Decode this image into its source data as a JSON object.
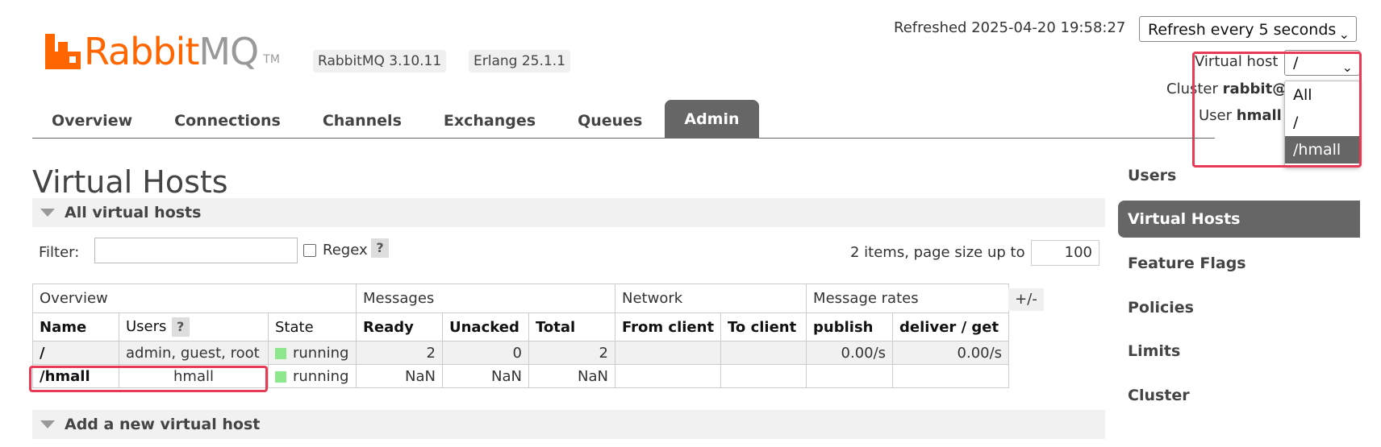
{
  "header": {
    "logo_rabbit": "Rabbit",
    "logo_mq": "MQ",
    "logo_tm": "TM",
    "rabbitmq_version": "RabbitMQ 3.10.11",
    "erlang_version": "Erlang 25.1.1",
    "refreshed_text": "Refreshed 2025-04-20 19:58:27",
    "refresh_select_value": "Refresh every 5 seconds",
    "virtual_host_label": "Virtual host",
    "virtual_host_value": "/",
    "virtual_host_options": [
      "All",
      "/",
      "/hmall"
    ],
    "virtual_host_highlighted": "/hmall",
    "cluster_label": "Cluster",
    "cluster_value": "rabbit@",
    "user_label": "User",
    "user_value": "hmall"
  },
  "tabs": [
    "Overview",
    "Connections",
    "Channels",
    "Exchanges",
    "Queues",
    "Admin"
  ],
  "active_tab": "Admin",
  "page_title": "Virtual Hosts",
  "section_all": "All virtual hosts",
  "filter": {
    "label": "Filter:",
    "value": "",
    "regex_label": "Regex",
    "help": "?",
    "items_text": "2 items, page size up to",
    "page_size": "100"
  },
  "table": {
    "groups": [
      "Overview",
      "Messages",
      "Network",
      "Message rates"
    ],
    "columns": [
      "Name",
      "Users",
      "State",
      "Ready",
      "Unacked",
      "Total",
      "From client",
      "To client",
      "publish",
      "deliver / get"
    ],
    "users_help": "?",
    "plus_minus": "+/-",
    "rows": [
      {
        "name": "/",
        "users": "admin, guest, root",
        "state": "running",
        "ready": "2",
        "unacked": "0",
        "total": "2",
        "from_client": "",
        "to_client": "",
        "publish": "0.00/s",
        "deliver_get": "0.00/s"
      },
      {
        "name": "/hmall",
        "users": "hmall",
        "state": "running",
        "ready": "NaN",
        "unacked": "NaN",
        "total": "NaN",
        "from_client": "",
        "to_client": "",
        "publish": "",
        "deliver_get": ""
      }
    ],
    "state_color": "#8de88d"
  },
  "section_add": "Add a new virtual host",
  "right_nav": [
    "Users",
    "Virtual Hosts",
    "Feature Flags",
    "Policies",
    "Limits",
    "Cluster"
  ],
  "right_nav_active": "Virtual Hosts",
  "colors": {
    "brand": "#ff6600",
    "highlight": "#e83a55",
    "tab_active": "#666666"
  }
}
